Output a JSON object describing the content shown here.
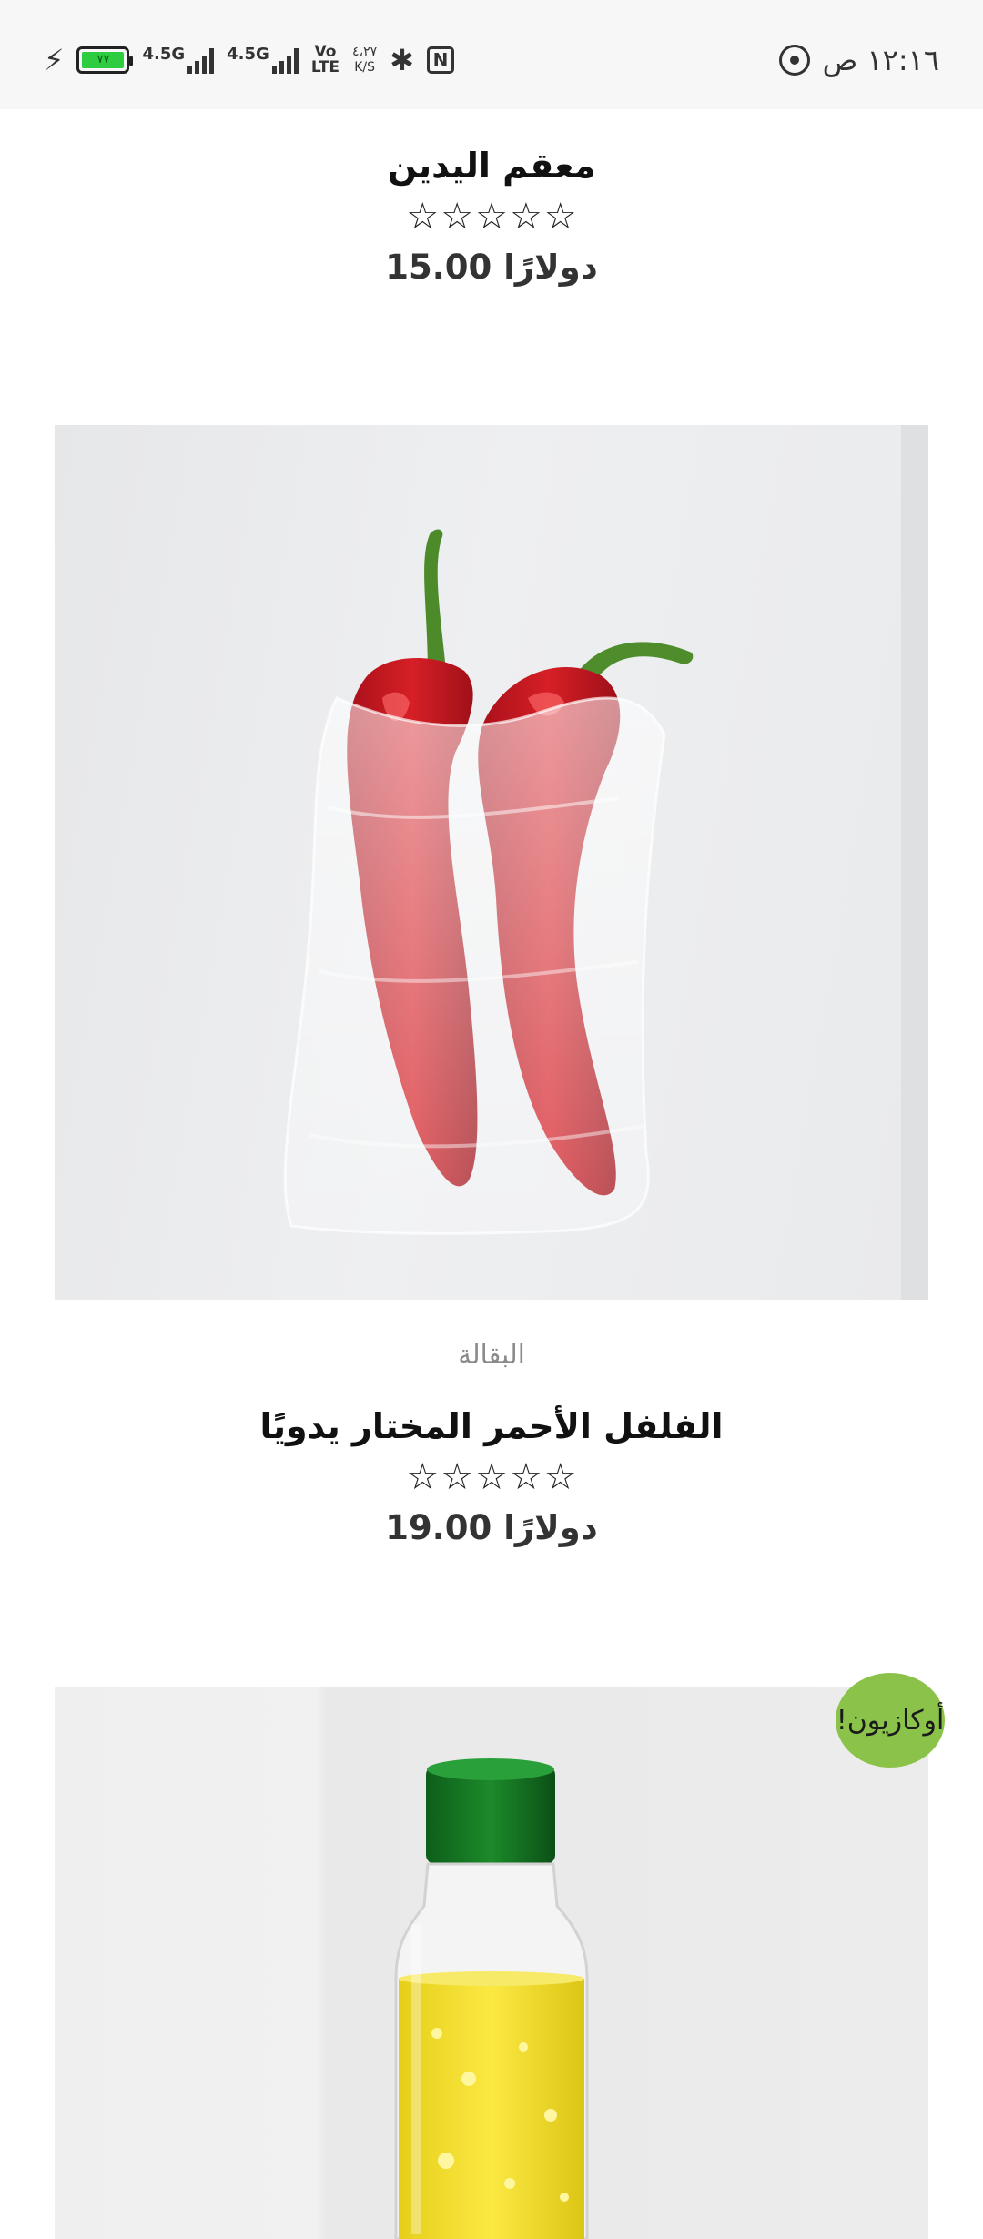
{
  "status_bar": {
    "time": "١٢:١٦ ص",
    "battery_level": "٧٧",
    "network_1": "4.5G",
    "network_2": "4.5G",
    "volte_top": "Vo",
    "volte_bottom": "LTE",
    "speed_value": "٤،٢٧",
    "speed_unit": "K/S",
    "icons": [
      "charging-icon",
      "battery-icon",
      "signal-icon",
      "signal-icon",
      "volte-icon",
      "bluetooth-icon",
      "nfc-icon",
      "whatsapp-icon"
    ]
  },
  "products": [
    {
      "title": "معقم اليدين",
      "rating_stars": 0,
      "price": "دولارًا 15.00"
    },
    {
      "category": "البقالة",
      "title": "الفلفل الأحمر المختار يدويًا",
      "rating_stars": 0,
      "price": "دولارًا 19.00"
    },
    {
      "sale_badge": "أوكازيون!"
    }
  ],
  "colors": {
    "status_bar_bg": "#f7f7f7",
    "sale_badge_bg": "#8bc34a",
    "category_text": "#8a8a8a",
    "battery_fill": "#2ecc40"
  }
}
